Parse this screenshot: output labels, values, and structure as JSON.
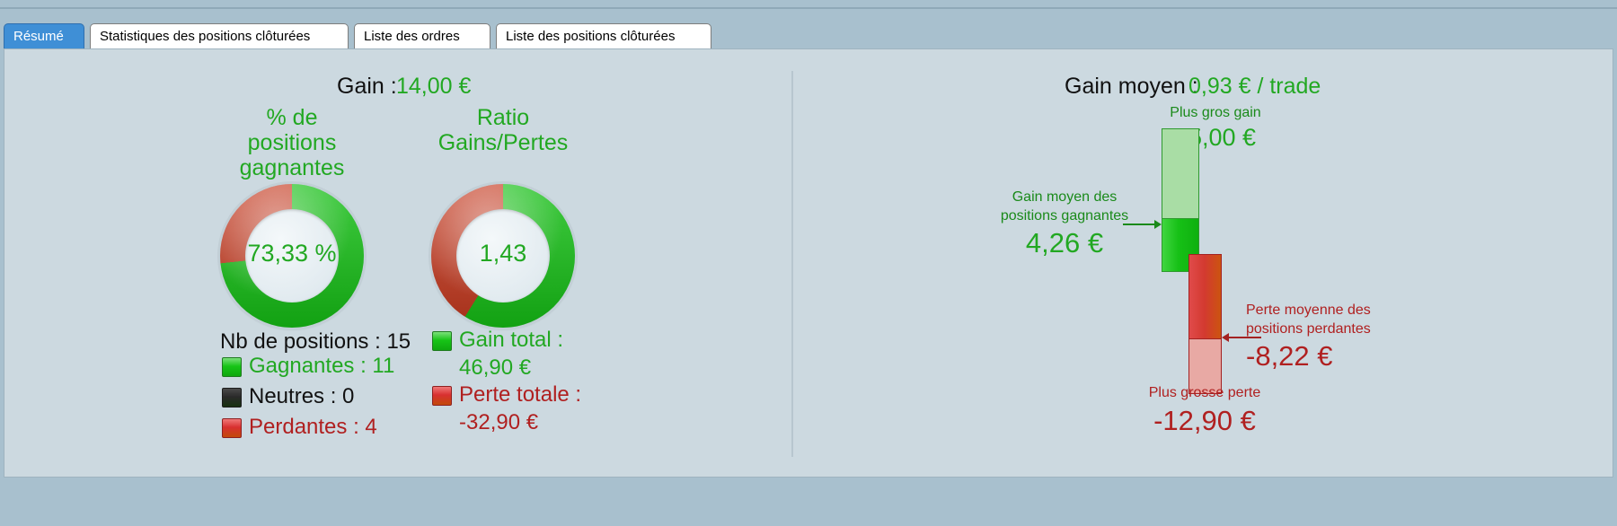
{
  "window": {
    "tabs": [
      {
        "label": "Résumé",
        "active": true
      },
      {
        "label": "Statistiques des positions clôturées",
        "active": false
      },
      {
        "label": "Liste des ordres",
        "active": false
      },
      {
        "label": "Liste des positions clôturées",
        "active": false
      }
    ]
  },
  "colors": {
    "accent_blue": "#3f8fd6",
    "panel_bg": "#ccd9e0",
    "green": "#22a822",
    "dark_green": "#1a8a1a",
    "red": "#b02020",
    "bar_green_light": "#a9dda5",
    "bar_green_dark": "#16c016",
    "bar_red_dark": "#d33a30",
    "bar_red_light": "#e8a9a4"
  },
  "left": {
    "header_label": "Gain :",
    "header_value": "14,00 €",
    "winrate": {
      "title_line1": "% de",
      "title_line2": "positions",
      "title_line3": "gagnantes",
      "value": "73,33 %"
    },
    "ratio": {
      "title_line1": "Ratio",
      "title_line2": "Gains/Pertes",
      "value": "1,43"
    },
    "legend_positions": {
      "total": "Nb de positions : 15",
      "items": [
        {
          "swatch": "green",
          "label": "Gagnantes : 11"
        },
        {
          "swatch": "neutral",
          "label": "Neutres : 0"
        },
        {
          "swatch": "red",
          "label": "Perdantes : 4"
        }
      ]
    },
    "legend_pnl": {
      "items": [
        {
          "swatch": "green",
          "label": "Gain total :",
          "value": "46,90 €"
        },
        {
          "swatch": "red",
          "label": "Perte totale :",
          "value": "-32,90 €"
        }
      ]
    }
  },
  "right": {
    "header_label": "Gain moyen :",
    "header_value": "0,93 € / trade",
    "biggest_gain": {
      "label": "Plus gros gain",
      "value": "15,00 €"
    },
    "avg_gain": {
      "label_line1": "Gain moyen des",
      "label_line2": "positions gagnantes",
      "value": "4,26 €"
    },
    "avg_loss": {
      "label_line1": "Perte moyenne des",
      "label_line2": "positions perdantes",
      "value": "-8,22 €"
    },
    "biggest_loss": {
      "label": "Plus grosse perte",
      "value": "-12,90 €"
    }
  },
  "chart_data": [
    {
      "type": "pie",
      "title": "% de positions gagnantes",
      "labels": [
        "Gagnantes",
        "Perdantes"
      ],
      "values": [
        73.33,
        26.67
      ],
      "unit": "%",
      "center_label": "73,33 %",
      "colors": [
        "#16c016",
        "#d33a30"
      ],
      "legend": "bottom"
    },
    {
      "type": "pie",
      "title": "Ratio Gains/Pertes",
      "labels": [
        "Gains",
        "Pertes"
      ],
      "values": [
        58.8,
        41.2
      ],
      "unit": "%",
      "center_label": "1,43",
      "colors": [
        "#16c016",
        "#d33a30"
      ],
      "legend": "bottom"
    },
    {
      "type": "bar",
      "title": "Gain moyen : 0,93 € / trade",
      "orientation": "vertical-waterfall",
      "categories": [
        "Plus gros gain",
        "Gain moyen des positions gagnantes",
        "Perte moyenne des positions perdantes",
        "Plus grosse perte"
      ],
      "values": [
        15.0,
        4.26,
        -8.22,
        -12.9
      ],
      "ylabel": "€",
      "ylim": [
        -12.9,
        15.0
      ],
      "grid": false
    }
  ]
}
